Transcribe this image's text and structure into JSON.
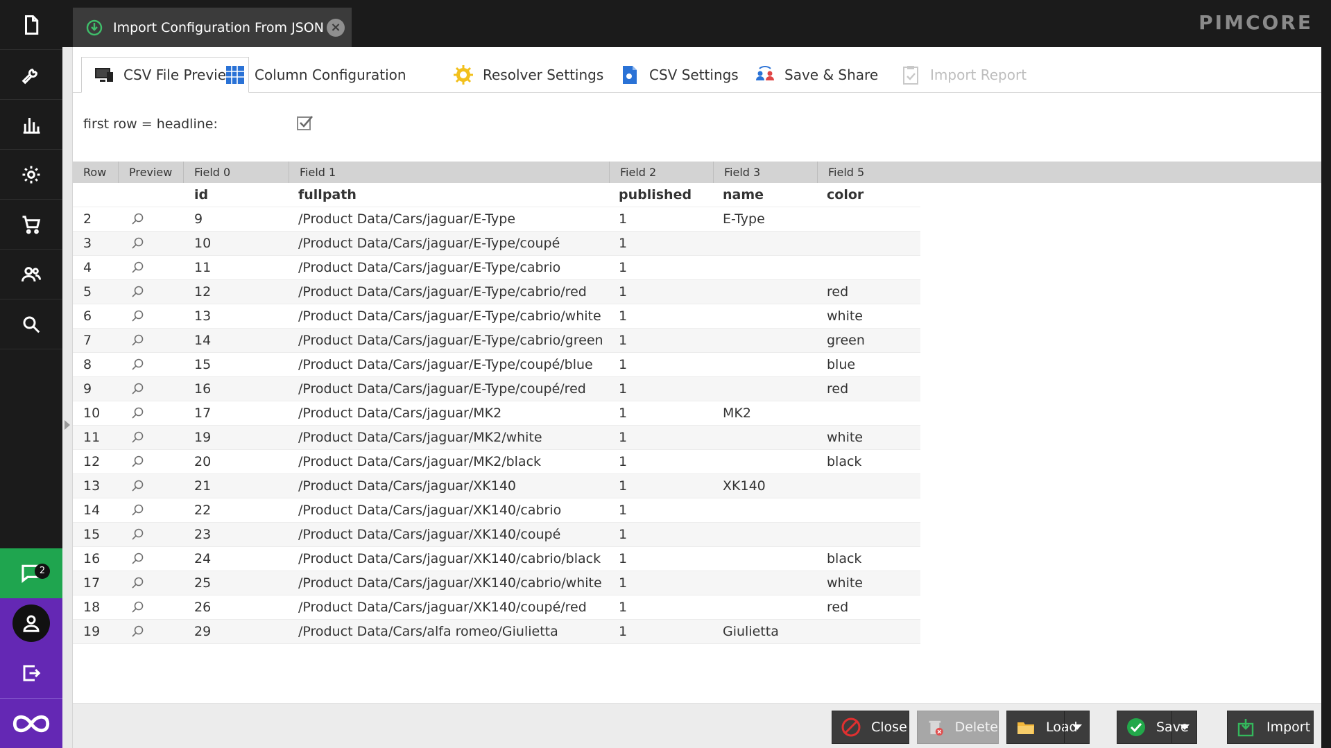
{
  "window": {
    "tab_title": "Import Configuration From JSON",
    "brand": "PIMCORE"
  },
  "sidebar": {
    "items": [
      {
        "icon": "document-icon"
      },
      {
        "icon": "wrench-icon"
      },
      {
        "icon": "bar-chart-icon"
      },
      {
        "icon": "gear-icon"
      },
      {
        "icon": "cart-icon"
      },
      {
        "icon": "users-icon"
      },
      {
        "icon": "search-icon"
      }
    ],
    "notifications_count": "2"
  },
  "tabs": [
    {
      "label": "CSV File Preview",
      "state": "active"
    },
    {
      "label": "Column Configuration",
      "state": "normal"
    },
    {
      "label": "Resolver Settings",
      "state": "normal"
    },
    {
      "label": "CSV Settings",
      "state": "normal"
    },
    {
      "label": "Save & Share",
      "state": "normal"
    },
    {
      "label": "Import Report",
      "state": "disabled"
    }
  ],
  "options": {
    "first_row_label": "first row = headline:",
    "first_row_checked": true
  },
  "grid": {
    "columns": [
      "Row",
      "Preview",
      "Field 0",
      "Field 1",
      "Field 2",
      "Field 3",
      "Field 5"
    ],
    "headline": [
      "",
      "",
      "id",
      "fullpath",
      "published",
      "name",
      "color"
    ],
    "rows": [
      [
        "2",
        "9",
        "/Product Data/Cars/jaguar/E-Type",
        "1",
        "E-Type",
        ""
      ],
      [
        "3",
        "10",
        "/Product Data/Cars/jaguar/E-Type/coupé",
        "1",
        "",
        ""
      ],
      [
        "4",
        "11",
        "/Product Data/Cars/jaguar/E-Type/cabrio",
        "1",
        "",
        ""
      ],
      [
        "5",
        "12",
        "/Product Data/Cars/jaguar/E-Type/cabrio/red",
        "1",
        "",
        "red"
      ],
      [
        "6",
        "13",
        "/Product Data/Cars/jaguar/E-Type/cabrio/white",
        "1",
        "",
        "white"
      ],
      [
        "7",
        "14",
        "/Product Data/Cars/jaguar/E-Type/cabrio/green",
        "1",
        "",
        "green"
      ],
      [
        "8",
        "15",
        "/Product Data/Cars/jaguar/E-Type/coupé/blue",
        "1",
        "",
        "blue"
      ],
      [
        "9",
        "16",
        "/Product Data/Cars/jaguar/E-Type/coupé/red",
        "1",
        "",
        "red"
      ],
      [
        "10",
        "17",
        "/Product Data/Cars/jaguar/MK2",
        "1",
        "MK2",
        ""
      ],
      [
        "11",
        "19",
        "/Product Data/Cars/jaguar/MK2/white",
        "1",
        "",
        "white"
      ],
      [
        "12",
        "20",
        "/Product Data/Cars/jaguar/MK2/black",
        "1",
        "",
        "black"
      ],
      [
        "13",
        "21",
        "/Product Data/Cars/jaguar/XK140",
        "1",
        "XK140",
        ""
      ],
      [
        "14",
        "22",
        "/Product Data/Cars/jaguar/XK140/cabrio",
        "1",
        "",
        ""
      ],
      [
        "15",
        "23",
        "/Product Data/Cars/jaguar/XK140/coupé",
        "1",
        "",
        ""
      ],
      [
        "16",
        "24",
        "/Product Data/Cars/jaguar/XK140/cabrio/black",
        "1",
        "",
        "black"
      ],
      [
        "17",
        "25",
        "/Product Data/Cars/jaguar/XK140/cabrio/white",
        "1",
        "",
        "white"
      ],
      [
        "18",
        "26",
        "/Product Data/Cars/jaguar/XK140/coupé/red",
        "1",
        "",
        "red"
      ],
      [
        "19",
        "29",
        "/Product Data/Cars/alfa romeo/Giulietta",
        "1",
        "Giulietta",
        ""
      ]
    ]
  },
  "footer": {
    "close": "Close",
    "delete": "Delete",
    "load": "Load",
    "save": "Save",
    "import": "Import"
  },
  "colors": {
    "accent_green": "#1fa54f",
    "accent_purple": "#6428b4",
    "dark": "#1b1b1b"
  }
}
